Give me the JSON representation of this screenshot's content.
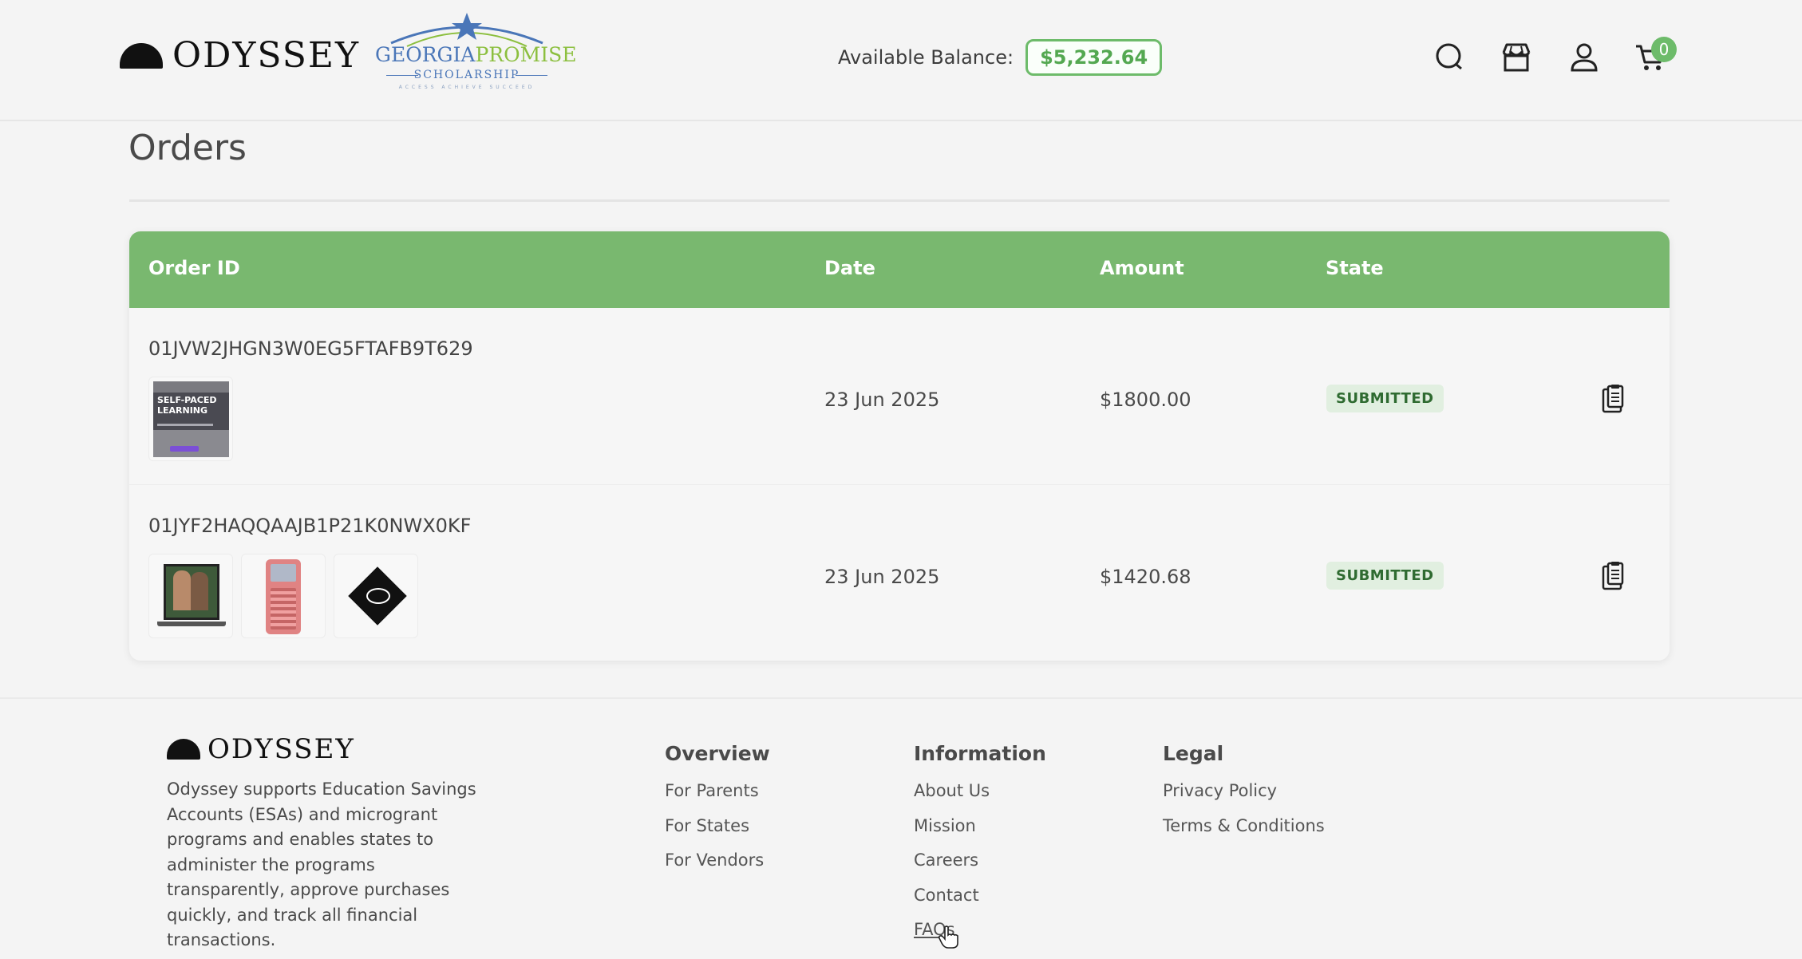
{
  "header": {
    "logo_text": "ODYSSEY",
    "partner_logo": {
      "word_georgia": "GEORGIA",
      "word_promise": "PROMISE",
      "sub": "SCHOLARSHIP",
      "tagline": "ACCESS ACHIEVE SUCCEED"
    },
    "balance_label": "Available Balance:",
    "balance_value": "$5,232.64",
    "cart_count": "0",
    "icons": [
      "search-icon",
      "store-icon",
      "user-icon",
      "cart-icon"
    ]
  },
  "page": {
    "title": "Orders"
  },
  "table": {
    "headers": {
      "order_id": "Order ID",
      "date": "Date",
      "amount": "Amount",
      "state": "State"
    },
    "rows": [
      {
        "order_id": "01JVW2JHGN3W0EG5FTAFB9T629",
        "date": "23 Jun 2025",
        "amount": "$1800.00",
        "state": "SUBMITTED",
        "thumb_text": [
          "SELF-PACED",
          "LEARNING"
        ]
      },
      {
        "order_id": "01JYF2HAQQAAJB1P21K0NWX0KF",
        "date": "23 Jun 2025",
        "amount": "$1420.68",
        "state": "SUBMITTED"
      }
    ]
  },
  "footer": {
    "logo_text": "ODYSSEY",
    "description": "Odyssey supports Education Savings Accounts (ESAs) and microgrant programs and enables states to administer the programs transparently, approve purchases quickly, and track all financial transactions.",
    "columns": [
      {
        "heading": "Overview",
        "links": [
          "For Parents",
          "For States",
          "For Vendors"
        ]
      },
      {
        "heading": "Information",
        "links": [
          "About Us",
          "Mission",
          "Careers",
          "Contact",
          "FAQs"
        ]
      },
      {
        "heading": "Legal",
        "links": [
          "Privacy Policy",
          "Terms & Conditions"
        ]
      }
    ]
  },
  "colors": {
    "accent_green": "#79b86f",
    "badge_bg": "#e1efe0",
    "badge_text": "#2f6b31",
    "balance_green": "#54a851"
  }
}
